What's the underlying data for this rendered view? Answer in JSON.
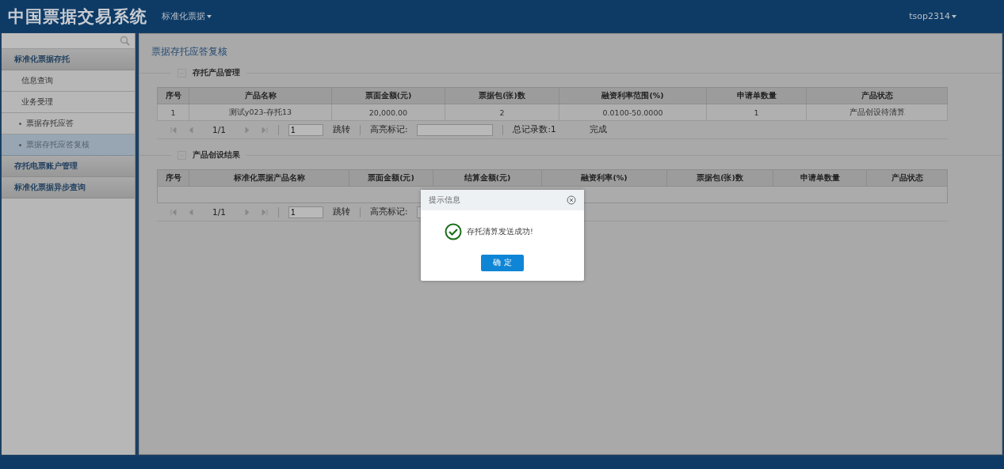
{
  "header": {
    "title": "中国票据交易系统",
    "module_menu": "标准化票据",
    "user_menu": "tsop2314"
  },
  "sidebar": {
    "groups": [
      {
        "label": "标准化票据存托",
        "children": [
          {
            "label": "信息查询",
            "selected": false
          },
          {
            "label": "业务受理",
            "selected": false,
            "children": [
              {
                "label": "票据存托应答",
                "selected": false
              },
              {
                "label": "票据存托应答复核",
                "selected": true
              }
            ]
          }
        ]
      },
      {
        "label": "存托电票账户管理"
      },
      {
        "label": "标准化票据异步查询"
      }
    ]
  },
  "page_title": "票据存托应答复核",
  "sections": [
    {
      "title": "存托产品管理",
      "table": {
        "columns": [
          "序号",
          "产品名称",
          "票面金额(元)",
          "票据包(张)数",
          "融资利率范围(%)",
          "申请单数量",
          "产品状态"
        ],
        "rows": [
          [
            "1",
            "测试y023-存托13",
            "20,000.00",
            "2",
            "0.0100-50.0000",
            "1",
            "产品创设待清算"
          ]
        ],
        "pager": {
          "page": "1/1",
          "jump_value": "1",
          "jump_label": "跳转",
          "highlight_label": "高亮标记:",
          "total": "总记录数:1",
          "status": "完成"
        }
      }
    },
    {
      "title": "产品创设结果",
      "table": {
        "columns": [
          "序号",
          "标准化票据产品名称",
          "票面金额(元)",
          "结算金额(元)",
          "融资利率(%)",
          "票据包(张)数",
          "申请单数量",
          "产品状态"
        ],
        "pager": {
          "page": "1/1",
          "jump_value": "1",
          "jump_label": "跳转",
          "highlight_label": "高亮标记:"
        }
      }
    }
  ],
  "dialog": {
    "title": "提示信息",
    "message": "存托清算发送成功!",
    "button": "确 定"
  }
}
